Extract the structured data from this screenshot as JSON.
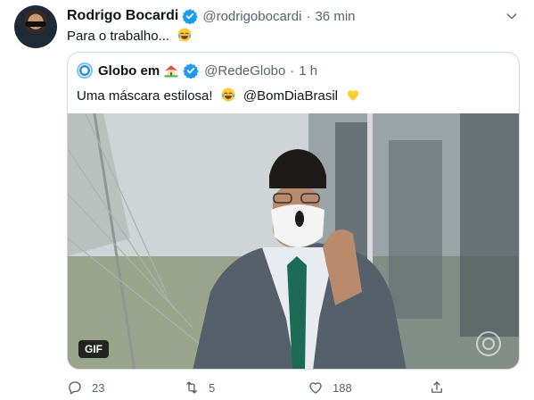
{
  "tweet": {
    "author_name": "Rodrigo Bocardi",
    "handle": "@rodrigobocardi",
    "separator": "·",
    "time": "36 min",
    "text": "Para o trabalho...",
    "text_emoji": "face-with-tears-of-joy-icon"
  },
  "quoted": {
    "author_name": "Globo em",
    "name_emoji": "house-with-garden-icon",
    "handle": "@RedeGlobo",
    "separator": "·",
    "time": "1 h",
    "text_prefix": "Uma máscara estilosa!",
    "mention": "@BomDiaBrasil",
    "media_badge": "GIF"
  },
  "actions": {
    "replies": "23",
    "retweets": "5",
    "likes": "188"
  },
  "colors": {
    "verified": "#1d9bf0",
    "muted": "#536471",
    "border": "#cfd9de",
    "text": "#0f1419"
  }
}
